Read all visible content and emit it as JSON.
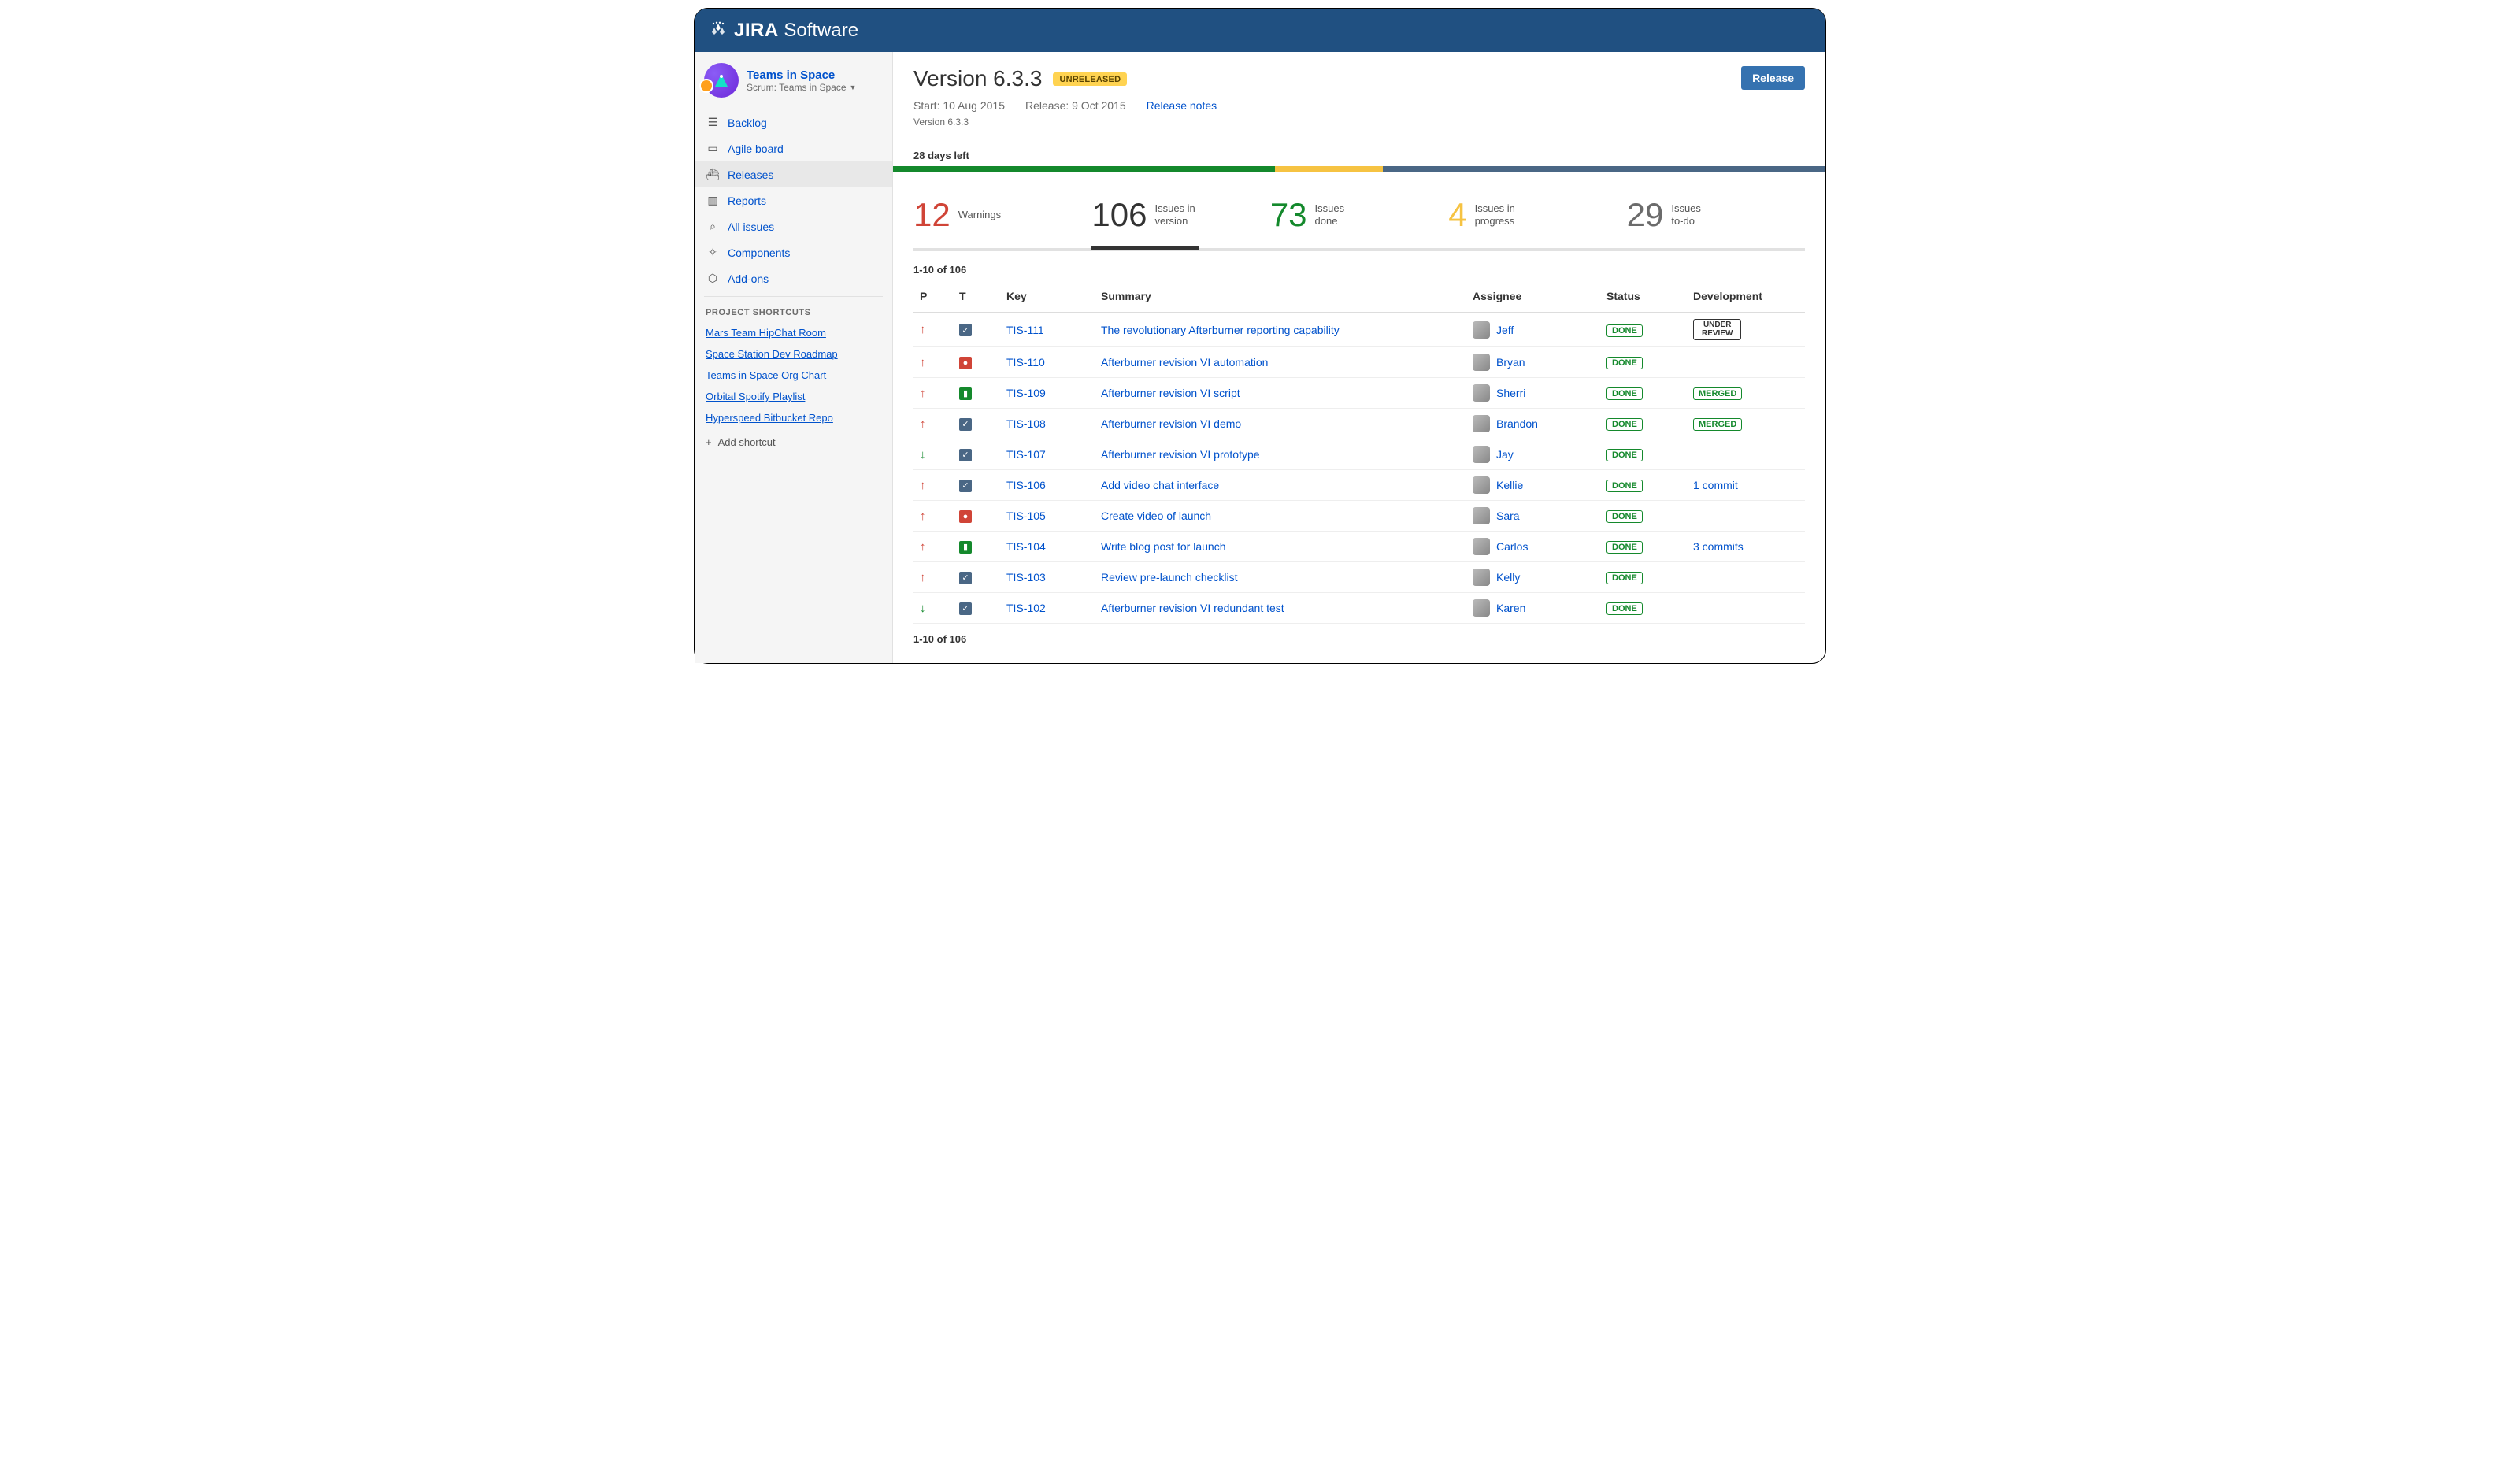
{
  "brand": {
    "name": "JIRA",
    "suffix": "Software"
  },
  "project": {
    "name": "Teams in Space",
    "meta": "Scrum: Teams in Space"
  },
  "sidebar": {
    "nav": [
      {
        "id": "backlog",
        "label": "Backlog"
      },
      {
        "id": "agile-board",
        "label": "Agile board"
      },
      {
        "id": "releases",
        "label": "Releases",
        "active": true
      },
      {
        "id": "reports",
        "label": "Reports"
      },
      {
        "id": "all-issues",
        "label": "All issues"
      },
      {
        "id": "components",
        "label": "Components"
      },
      {
        "id": "add-ons",
        "label": "Add-ons"
      }
    ],
    "shortcuts_heading": "PROJECT SHORTCUTS",
    "shortcuts": [
      "Mars Team HipChat Room",
      "Space Station Dev Roadmap",
      "Teams in Space Org Chart",
      "Orbital Spotify Playlist",
      "Hyperspeed Bitbucket Repo"
    ],
    "add_shortcut": "Add shortcut"
  },
  "page": {
    "title": "Version 6.3.3",
    "badge": "UNRELEASED",
    "release_button": "Release",
    "start": "Start: 10 Aug 2015",
    "release_date": "Release: 9 Oct 2015",
    "release_notes": "Release notes",
    "breadcrumb": "Version 6.3.3",
    "days_left": "28 days left"
  },
  "progress": {
    "green_pct": 41,
    "yellow_pct": 11.5,
    "blue_pct": 47.5
  },
  "stats": [
    {
      "num": "12",
      "label": "Warnings",
      "color": "c-red"
    },
    {
      "num": "106",
      "label": "Issues in version",
      "color": "c-dark",
      "active": true
    },
    {
      "num": "73",
      "label": "Issues done",
      "color": "c-green"
    },
    {
      "num": "4",
      "label": "Issues in progress",
      "color": "c-yellow"
    },
    {
      "num": "29",
      "label": "Issues to-do",
      "color": "c-grey"
    }
  ],
  "table": {
    "range": "1-10 of 106",
    "columns": {
      "p": "P",
      "t": "T",
      "key": "Key",
      "summary": "Summary",
      "assignee": "Assignee",
      "status": "Status",
      "dev": "Development"
    },
    "rows": [
      {
        "prio": "high",
        "type": "check",
        "key": "TIS-111",
        "summary": "The revolutionary Afterburner reporting capability",
        "assignee": "Jeff",
        "status": "DONE",
        "dev": {
          "kind": "review",
          "l1": "UNDER",
          "l2": "REVIEW"
        }
      },
      {
        "prio": "high",
        "type": "bug",
        "key": "TIS-110",
        "summary": "Afterburner revision VI automation",
        "assignee": "Bryan",
        "status": "DONE",
        "dev": null
      },
      {
        "prio": "high",
        "type": "story",
        "key": "TIS-109",
        "summary": "Afterburner revision VI script",
        "assignee": "Sherri",
        "status": "DONE",
        "dev": {
          "kind": "merged",
          "text": "MERGED"
        }
      },
      {
        "prio": "high",
        "type": "check",
        "key": "TIS-108",
        "summary": "Afterburner revision VI demo",
        "assignee": "Brandon",
        "status": "DONE",
        "dev": {
          "kind": "merged",
          "text": "MERGED"
        }
      },
      {
        "prio": "low",
        "type": "check",
        "key": "TIS-107",
        "summary": "Afterburner revision VI prototype",
        "assignee": "Jay",
        "status": "DONE",
        "dev": null
      },
      {
        "prio": "high",
        "type": "check",
        "key": "TIS-106",
        "summary": "Add video chat interface",
        "assignee": "Kellie",
        "status": "DONE",
        "dev": {
          "kind": "link",
          "text": "1 commit"
        }
      },
      {
        "prio": "high",
        "type": "bug",
        "key": "TIS-105",
        "summary": "Create video of launch",
        "assignee": "Sara",
        "status": "DONE",
        "dev": null
      },
      {
        "prio": "high",
        "type": "story",
        "key": "TIS-104",
        "summary": "Write blog post for launch",
        "assignee": "Carlos",
        "status": "DONE",
        "dev": {
          "kind": "link",
          "text": "3 commits"
        }
      },
      {
        "prio": "high",
        "type": "check",
        "key": "TIS-103",
        "summary": "Review pre-launch checklist",
        "assignee": "Kelly",
        "status": "DONE",
        "dev": null
      },
      {
        "prio": "low",
        "type": "check",
        "key": "TIS-102",
        "summary": "Afterburner revision VI redundant test",
        "assignee": "Karen",
        "status": "DONE",
        "dev": null
      }
    ]
  }
}
